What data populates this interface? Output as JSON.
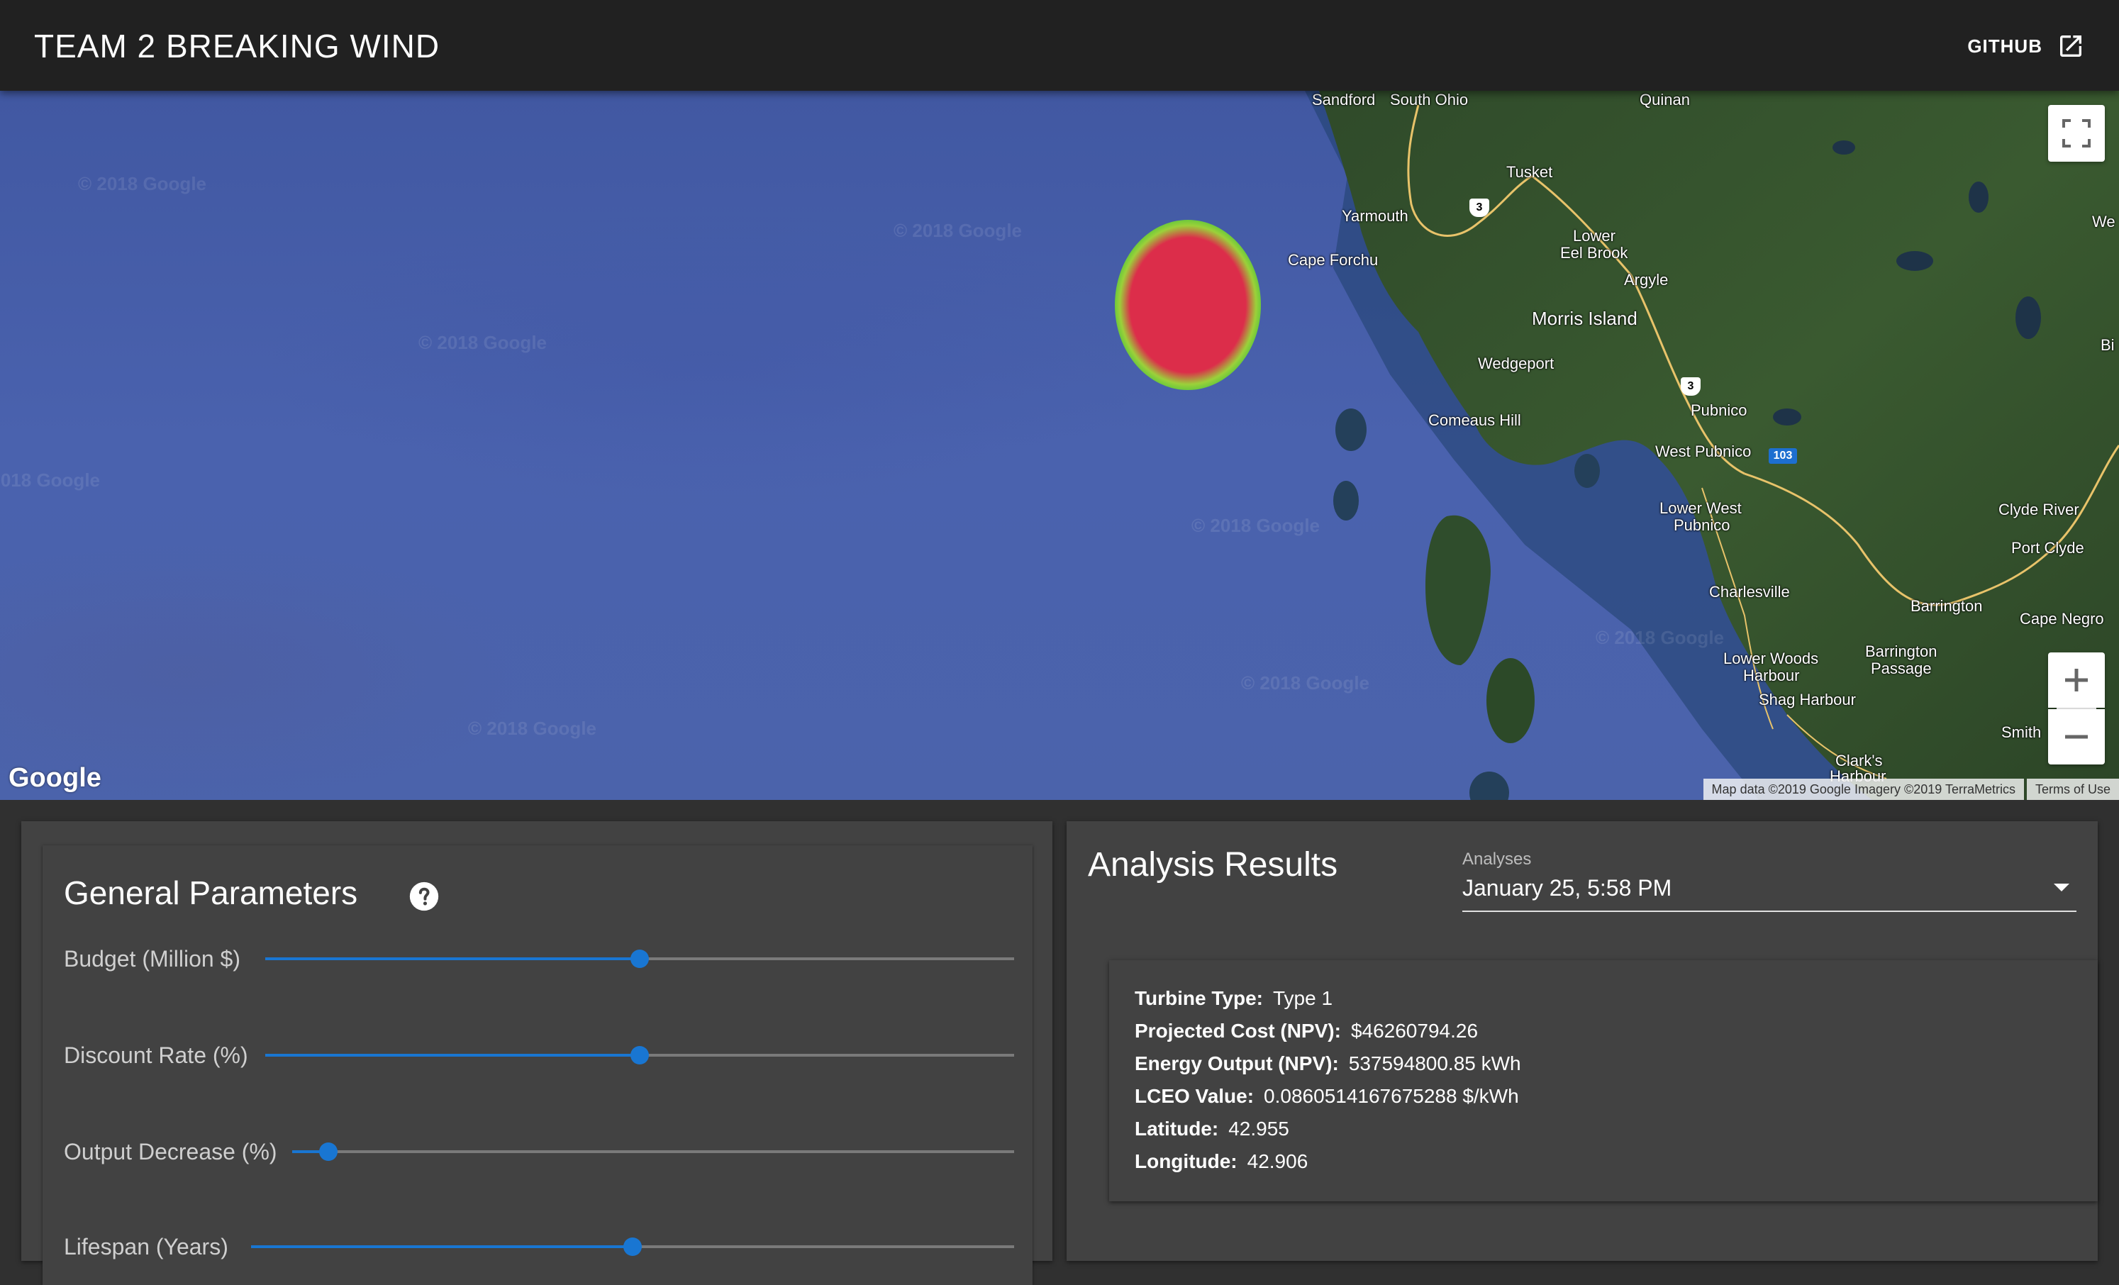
{
  "header": {
    "title_bold": "TEAM 2",
    "title_light": "BREAKING WIND",
    "github_label": "GITHUB",
    "github_icon": "external-link-icon"
  },
  "map": {
    "watermark": "© 2018 Google",
    "logo": "Google",
    "attribution": "Map data ©2019 Google Imagery ©2019 TerraMetrics",
    "terms": "Terms of Use",
    "places": {
      "sandford": "Sandford",
      "south_ohio": "South Ohio",
      "quinan": "Quinan",
      "tusket": "Tusket",
      "yarmouth": "Yarmouth",
      "lower_eel_brook_1": "Lower",
      "lower_eel_brook_2": "Eel Brook",
      "argyle": "Argyle",
      "cape_forchu": "Cape Forchu",
      "morris_island": "Morris Island",
      "wedgeport": "Wedgeport",
      "pubnico": "Pubnico",
      "comeaus_hill": "Comeaus Hill",
      "west_pubnico": "West Pubnico",
      "lower_west_pubnico_1": "Lower West",
      "lower_west_pubnico_2": "Pubnico",
      "clyde_river": "Clyde River",
      "port_clyde": "Port Clyde",
      "charlesville": "Charlesville",
      "barrington": "Barrington",
      "cape_negro": "Cape Negro",
      "lower_woods_harbour_1": "Lower Woods",
      "lower_woods_harbour_2": "Harbour",
      "barrington_passage_1": "Barrington",
      "barrington_passage_2": "Passage",
      "shag_harbour": "Shag Harbour",
      "smith": "Smith",
      "clarks_harbour_1": "Clark's",
      "clarks_harbour_2": "Harbour",
      "we": "We",
      "bi": "Bi"
    },
    "shields": {
      "hwy3_a": "3",
      "hwy3_b": "3",
      "hwy103": "103"
    },
    "heatmap_colors": [
      "#dc2d4a",
      "#9bd13a",
      "#4fc33c"
    ]
  },
  "general_parameters": {
    "title": "General Parameters",
    "help_icon": "help-circle-icon",
    "sliders": [
      {
        "label": "Budget (Million $)",
        "value_fraction": 0.5
      },
      {
        "label": "Discount Rate (%)",
        "value_fraction": 0.5
      },
      {
        "label": "Output Decrease (%)",
        "value_fraction": 0.05
      },
      {
        "label": "Lifespan (Years)",
        "value_fraction": 0.5
      }
    ]
  },
  "analysis_results": {
    "title": "Analysis Results",
    "select_label": "Analyses",
    "select_value": "January 25, 5:58 PM",
    "results": [
      {
        "key": "Turbine Type:",
        "value": "Type 1"
      },
      {
        "key": "Projected Cost (NPV):",
        "value": "$46260794.26"
      },
      {
        "key": "Energy Output (NPV):",
        "value": "537594800.85 kWh"
      },
      {
        "key": "LCEO Value:",
        "value": "0.0860514167675288 $/kWh"
      },
      {
        "key": "Latitude:",
        "value": "42.955"
      },
      {
        "key": "Longitude:",
        "value": "42.906"
      }
    ]
  },
  "colors": {
    "header_bg": "#212121",
    "panel_bg": "#424242",
    "page_bg": "#303030",
    "accent": "#1976d2"
  }
}
